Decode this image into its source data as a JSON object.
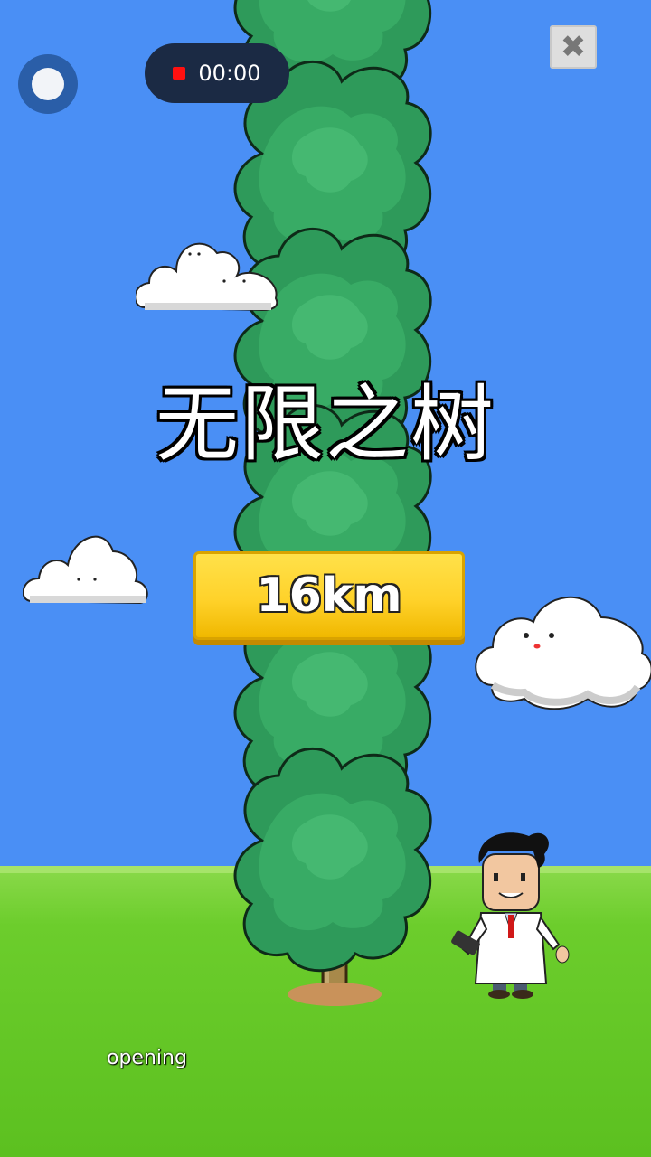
{
  "game": {
    "title": "无限之树",
    "distance": "16km",
    "status": "opening"
  },
  "hud": {
    "recording_time": "00:00"
  },
  "colors": {
    "sky": "#4a8ff5",
    "grass": "#6ccd2c",
    "foliage": "#2e9a5a",
    "badge": "#ffd22a"
  },
  "icons": {
    "record": "record-toggle-icon",
    "stop": "stop-icon",
    "close": "close-icon"
  }
}
